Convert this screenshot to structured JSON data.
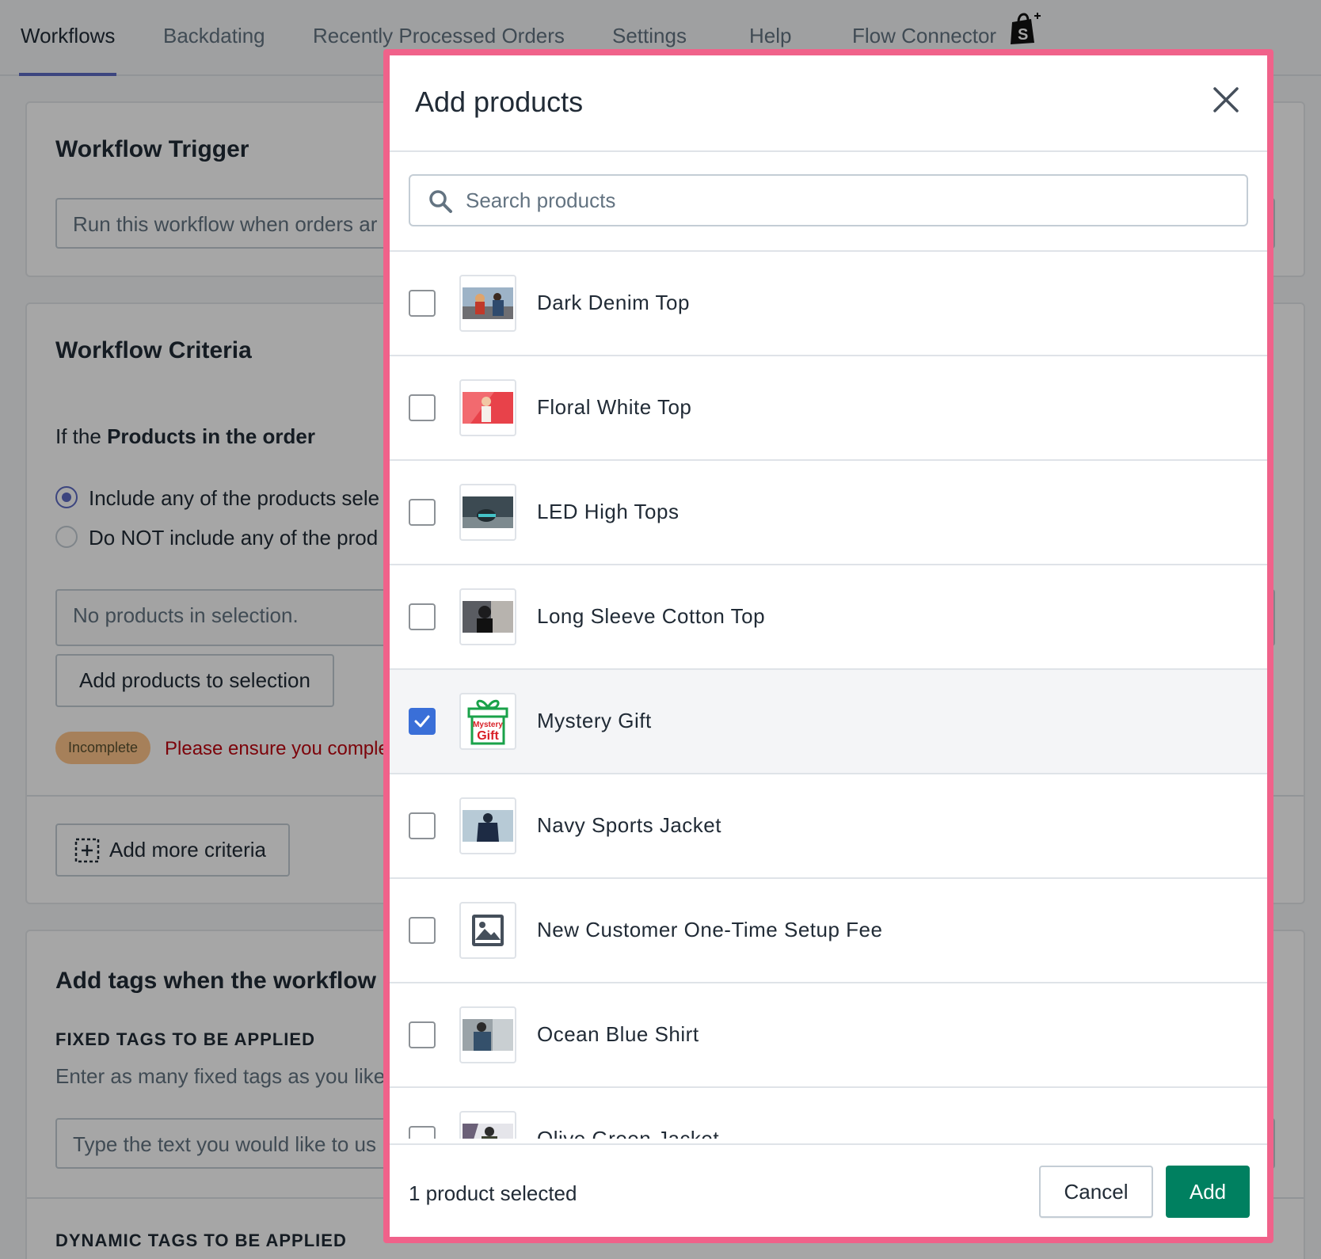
{
  "nav": {
    "tabs": [
      "Workflows",
      "Backdating",
      "Recently Processed Orders",
      "Settings",
      "Help",
      "Flow Connector"
    ],
    "active_tab": "Workflows"
  },
  "trigger": {
    "title": "Workflow Trigger",
    "field_text": "Run this workflow when orders ar"
  },
  "criteria": {
    "title": "Workflow Criteria",
    "condition_prefix": "If the",
    "condition_strong": "Products in the order",
    "options": [
      "Include any of the products sele",
      "Do NOT include any of the prod"
    ],
    "selected_option": 0,
    "empty_selection": "No products in selection.",
    "add_products_button": "Add products to selection",
    "status_badge": "Incomplete",
    "status_message": "Please ensure you complet",
    "add_more_button": "Add more criteria"
  },
  "tags": {
    "title": "Add tags when the workflow m",
    "fixed_label": "FIXED TAGS TO BE APPLIED",
    "fixed_help": "Enter as many fixed tags as you like",
    "fixed_placeholder": "Type the text you would like to us",
    "dynamic_label": "DYNAMIC TAGS TO BE APPLIED"
  },
  "modal": {
    "title": "Add products",
    "search_placeholder": "Search products",
    "products": [
      {
        "name": "Dark Denim Top",
        "checked": false,
        "thumb": "photo"
      },
      {
        "name": "Floral White Top",
        "checked": false,
        "thumb": "photo"
      },
      {
        "name": "LED High Tops",
        "checked": false,
        "thumb": "photo"
      },
      {
        "name": "Long Sleeve Cotton Top",
        "checked": false,
        "thumb": "photo"
      },
      {
        "name": "Mystery Gift",
        "checked": true,
        "thumb": "mystery-gift"
      },
      {
        "name": "Navy Sports Jacket",
        "checked": false,
        "thumb": "photo"
      },
      {
        "name": "New Customer One-Time Setup Fee",
        "checked": false,
        "thumb": "placeholder"
      },
      {
        "name": "Ocean Blue Shirt",
        "checked": false,
        "thumb": "photo"
      },
      {
        "name": "Olive Green Jacket",
        "checked": false,
        "thumb": "photo"
      }
    ],
    "gift_text_top": "Mystery",
    "gift_text_bottom": "Gift",
    "selected_count_text": "1 product selected",
    "cancel_label": "Cancel",
    "add_label": "Add"
  },
  "colors": {
    "highlight_border": "#f0628a",
    "primary": "#008060",
    "checkbox": "#3a6fd8",
    "nav_accent": "#5c6ac4"
  }
}
